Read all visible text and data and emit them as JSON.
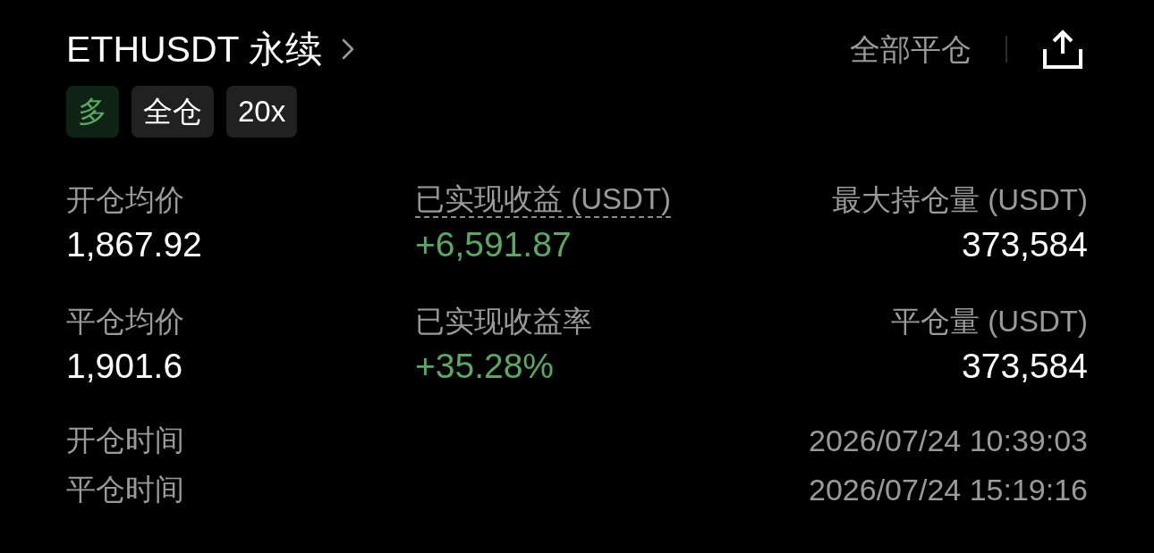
{
  "header": {
    "title": "ETHUSDT 永续",
    "close_all_button": "全部平仓"
  },
  "tags": [
    {
      "label": "多",
      "kind": "side"
    },
    {
      "label": "全仓",
      "kind": "plain"
    },
    {
      "label": "20x",
      "kind": "plain"
    }
  ],
  "stats": [
    {
      "label": "开仓均价",
      "value": "1,867.92",
      "kind": "plain",
      "underlined": false
    },
    {
      "label": "已实现收益 (USDT)",
      "value": "+6,591.87",
      "kind": "profit",
      "underlined": true
    },
    {
      "label": "最大持仓量 (USDT)",
      "value": "373,584",
      "kind": "plain",
      "underlined": false
    },
    {
      "label": "平仓均价",
      "value": "1,901.6",
      "kind": "plain",
      "underlined": false
    },
    {
      "label": "已实现收益率",
      "value": "+35.28%",
      "kind": "profit",
      "underlined": false
    },
    {
      "label": "平仓量 (USDT)",
      "value": "373,584",
      "kind": "plain",
      "underlined": false
    }
  ],
  "times": [
    {
      "label": "开仓时间",
      "value": "2026/07/24 10:39:03"
    },
    {
      "label": "平仓时间",
      "value": "2026/07/24 15:19:16"
    }
  ]
}
